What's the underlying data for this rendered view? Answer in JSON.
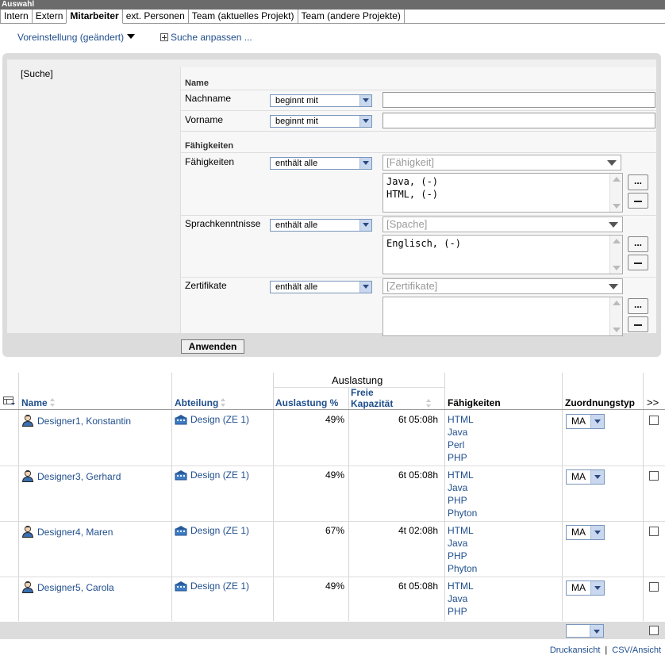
{
  "window": {
    "title": "Auswahl"
  },
  "tabs": [
    {
      "label": "Intern",
      "active": false
    },
    {
      "label": "Extern",
      "active": false
    },
    {
      "label": "Mitarbeiter",
      "active": true
    },
    {
      "label": "ext. Personen",
      "active": false
    },
    {
      "label": "Team (aktuelles Projekt)",
      "active": false
    },
    {
      "label": "Team (andere Projekte)",
      "active": false
    }
  ],
  "toolbar": {
    "preset_label": "Voreinstellung (geändert)",
    "customize_label": "Suche anpassen ..."
  },
  "search": {
    "label": "[Suche]",
    "name_section": "Name",
    "lastname_label": "Nachname",
    "lastname_mode": "beginnt mit",
    "lastname_value": "",
    "firstname_label": "Vorname",
    "firstname_mode": "beginnt mit",
    "firstname_value": "",
    "skills_section": "Fähigkeiten",
    "skills_label": "Fähigkeiten",
    "skills_mode": "enthält alle",
    "skills_placeholder": "[Fähigkeit]",
    "skills_items": [
      "Java, (-)",
      "HTML, (-)"
    ],
    "languages_label": "Sprachkenntnisse",
    "languages_mode": "enthält alle",
    "languages_placeholder": "[Spache]",
    "languages_items": [
      "Englisch, (-)"
    ],
    "certs_label": "Zertifikate",
    "certs_mode": "enthält alle",
    "certs_placeholder": "[Zertifikate]",
    "certs_items": [],
    "add_button": "...",
    "apply_button": "Anwenden"
  },
  "table": {
    "group_header": "Auslastung",
    "headers": {
      "name": "Name",
      "department": "Abteilung",
      "utilization": "Auslastung %",
      "free_capacity_1": "Freie",
      "free_capacity_2": "Kapazität",
      "skills": "Fähigkeiten",
      "assignment_type": "Zuordnungstyp",
      "more": ">>"
    },
    "rows": [
      {
        "name": "Designer1, Konstantin",
        "department": "Design (ZE 1)",
        "utilization": "49%",
        "free": "6t 05:08h",
        "skills": [
          "HTML",
          "Java",
          "Perl",
          "PHP"
        ],
        "assignment": "MA"
      },
      {
        "name": "Designer3, Gerhard",
        "department": "Design (ZE 1)",
        "utilization": "49%",
        "free": "6t 05:08h",
        "skills": [
          "HTML",
          "Java",
          "PHP",
          "Phyton"
        ],
        "assignment": "MA"
      },
      {
        "name": "Designer4, Maren",
        "department": "Design (ZE 1)",
        "utilization": "67%",
        "free": "4t 02:08h",
        "skills": [
          "HTML",
          "Java",
          "PHP",
          "Phyton"
        ],
        "assignment": "MA"
      },
      {
        "name": "Designer5, Carola",
        "department": "Design (ZE 1)",
        "utilization": "49%",
        "free": "6t 05:08h",
        "skills": [
          "HTML",
          "Java",
          "PHP"
        ],
        "assignment": "MA"
      }
    ],
    "footer_select": ""
  },
  "footer": {
    "print_view": "Druckansicht",
    "csv_view": "CSV/Ansicht"
  },
  "colors": {
    "link": "#1f4e8c",
    "panel_bg": "#dcdcdc",
    "titlebar": "#6b6b6b"
  }
}
